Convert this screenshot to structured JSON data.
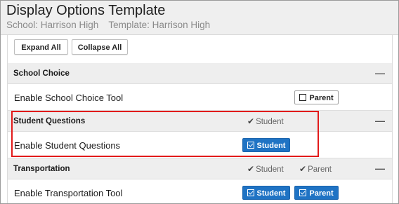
{
  "header": {
    "title": "Display Options Template",
    "school": "School: Harrison High",
    "template": "Template: Harrison High"
  },
  "toolbar": {
    "expand_label": "Expand All",
    "collapse_label": "Collapse All"
  },
  "sections": [
    {
      "name": "School Choice",
      "checks": [],
      "item_label": "Enable School Choice Tool",
      "toggles": [
        {
          "label": "Parent",
          "checked": false
        }
      ]
    },
    {
      "name": "Student Questions",
      "checks": [
        "Student"
      ],
      "item_label": "Enable Student Questions",
      "toggles": [
        {
          "label": "Student",
          "checked": true
        }
      ]
    },
    {
      "name": "Transportation",
      "checks": [
        "Student",
        "Parent"
      ],
      "item_label": "Enable Transportation Tool",
      "toggles": [
        {
          "label": "Student",
          "checked": true
        },
        {
          "label": "Parent",
          "checked": true
        }
      ]
    }
  ],
  "collapse_symbol": "—",
  "colors": {
    "accent": "#1f73c4",
    "highlight": "#e21b1b",
    "section_bg": "#eeeeee"
  }
}
